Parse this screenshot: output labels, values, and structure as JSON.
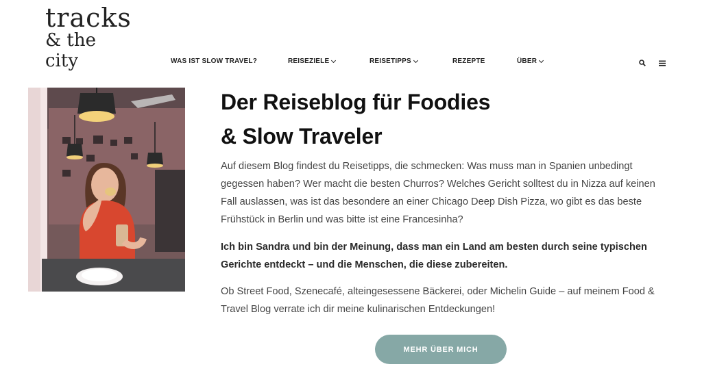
{
  "brand": {
    "line1": "tracks",
    "line2": "& the city"
  },
  "nav": {
    "items": [
      {
        "label": "WAS IST SLOW TRAVEL?",
        "dropdown": false
      },
      {
        "label": "REISEZIELE",
        "dropdown": true
      },
      {
        "label": "REISETIPPS",
        "dropdown": true
      },
      {
        "label": "REZEPTE",
        "dropdown": false
      },
      {
        "label": "ÜBER",
        "dropdown": true
      }
    ],
    "icons": [
      "search-icon",
      "hamburger-menu-icon"
    ]
  },
  "hero": {
    "title_line1": "Der Reiseblog für Foodies",
    "title_line2": "& Slow Traveler",
    "paragraph1": "Auf diesem Blog findest du Reisetipps, die schmecken: Was muss man in Spanien unbedingt gegessen haben? Wer macht die besten Churros? Welches Gericht solltest du in Nizza auf keinen Fall auslassen, was ist das besondere an einer Chicago Deep Dish Pizza, wo gibt es das beste Frühstück in Berlin und was bitte ist eine Francesinha?",
    "paragraph2": "Ich bin Sandra und bin der Meinung, dass man ein Land am besten durch seine typischen Gerichte entdeckt – und die Menschen, die diese zubereiten.",
    "paragraph3": "Ob Street Food, Szenecafé, alteingesessene Bäckerei, oder Michelin Guide – auf meinem Food & Travel Blog verrate ich dir meine kulinarischen Entdeckungen!",
    "cta_label": "MEHR ÜBER MICH"
  },
  "colors": {
    "accent": "#86a8a6",
    "text": "#444444",
    "heading": "#111111"
  }
}
